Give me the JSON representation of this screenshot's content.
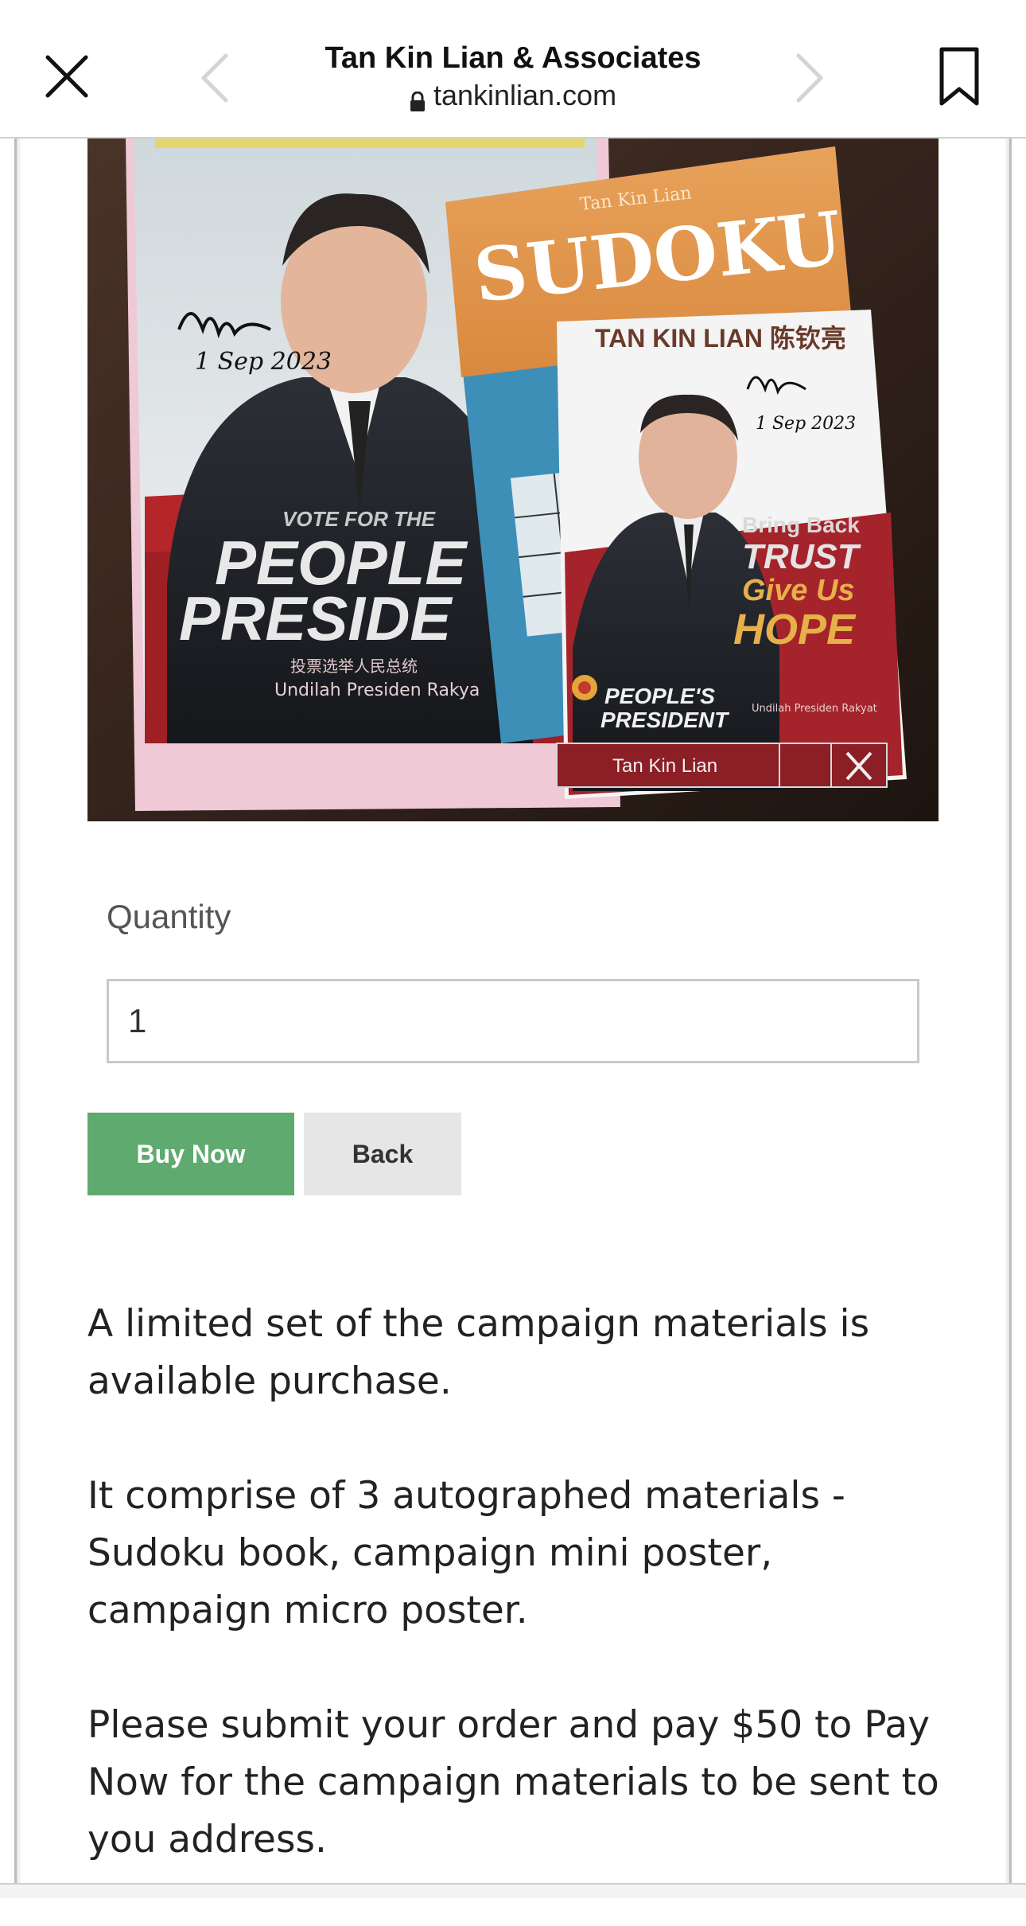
{
  "browser": {
    "title": "Tan Kin Lian & Associates",
    "url": "tankinlian.com",
    "icons": [
      "close-icon",
      "chevron-left-icon",
      "chevron-right-icon",
      "bookmark-icon",
      "lock-icon"
    ]
  },
  "product_photo": {
    "description": "Autographed Sudoku book and campaign posters",
    "poster_left": {
      "signature_date": "1 Sep 2023",
      "vote_for": "VOTE FOR THE",
      "headline_1": "PEOPLE",
      "headline_2": "PRESIDE",
      "chinese": "投票选举人民总统",
      "malay": "Undilah Presiden Rakya"
    },
    "book": {
      "author": "Tan Kin Lian",
      "title": "SUDOKU"
    },
    "poster_small": {
      "name_banner": "TAN KIN LIAN 陈钦亮",
      "signature_date": "1 Sep 2023",
      "tag_1": "Bring Back",
      "tag_2": "TRUST",
      "tag_3": "Give Us",
      "tag_4": "HOPE",
      "logo_1": "PEOPLE'S",
      "logo_2": "PRESIDENT",
      "malay": "Undilah Presiden Rakyat",
      "ballot_name": "Tan Kin Lian"
    }
  },
  "form": {
    "quantity_label": "Quantity",
    "quantity_value": "1",
    "buy_label": "Buy Now",
    "back_label": "Back"
  },
  "description": {
    "p1": "A limited set of the campaign materials is available purchase.",
    "p2": "It comprise of 3 autographed materials - Sudoku book, campaign mini poster, campaign micro poster.",
    "p3": "Please submit your order and pay $50 to Pay Now for the campaign materials to be sent to you address."
  },
  "colors": {
    "buy_button": "#5faa6f",
    "back_button": "#e6e6e6",
    "text": "#222222"
  }
}
